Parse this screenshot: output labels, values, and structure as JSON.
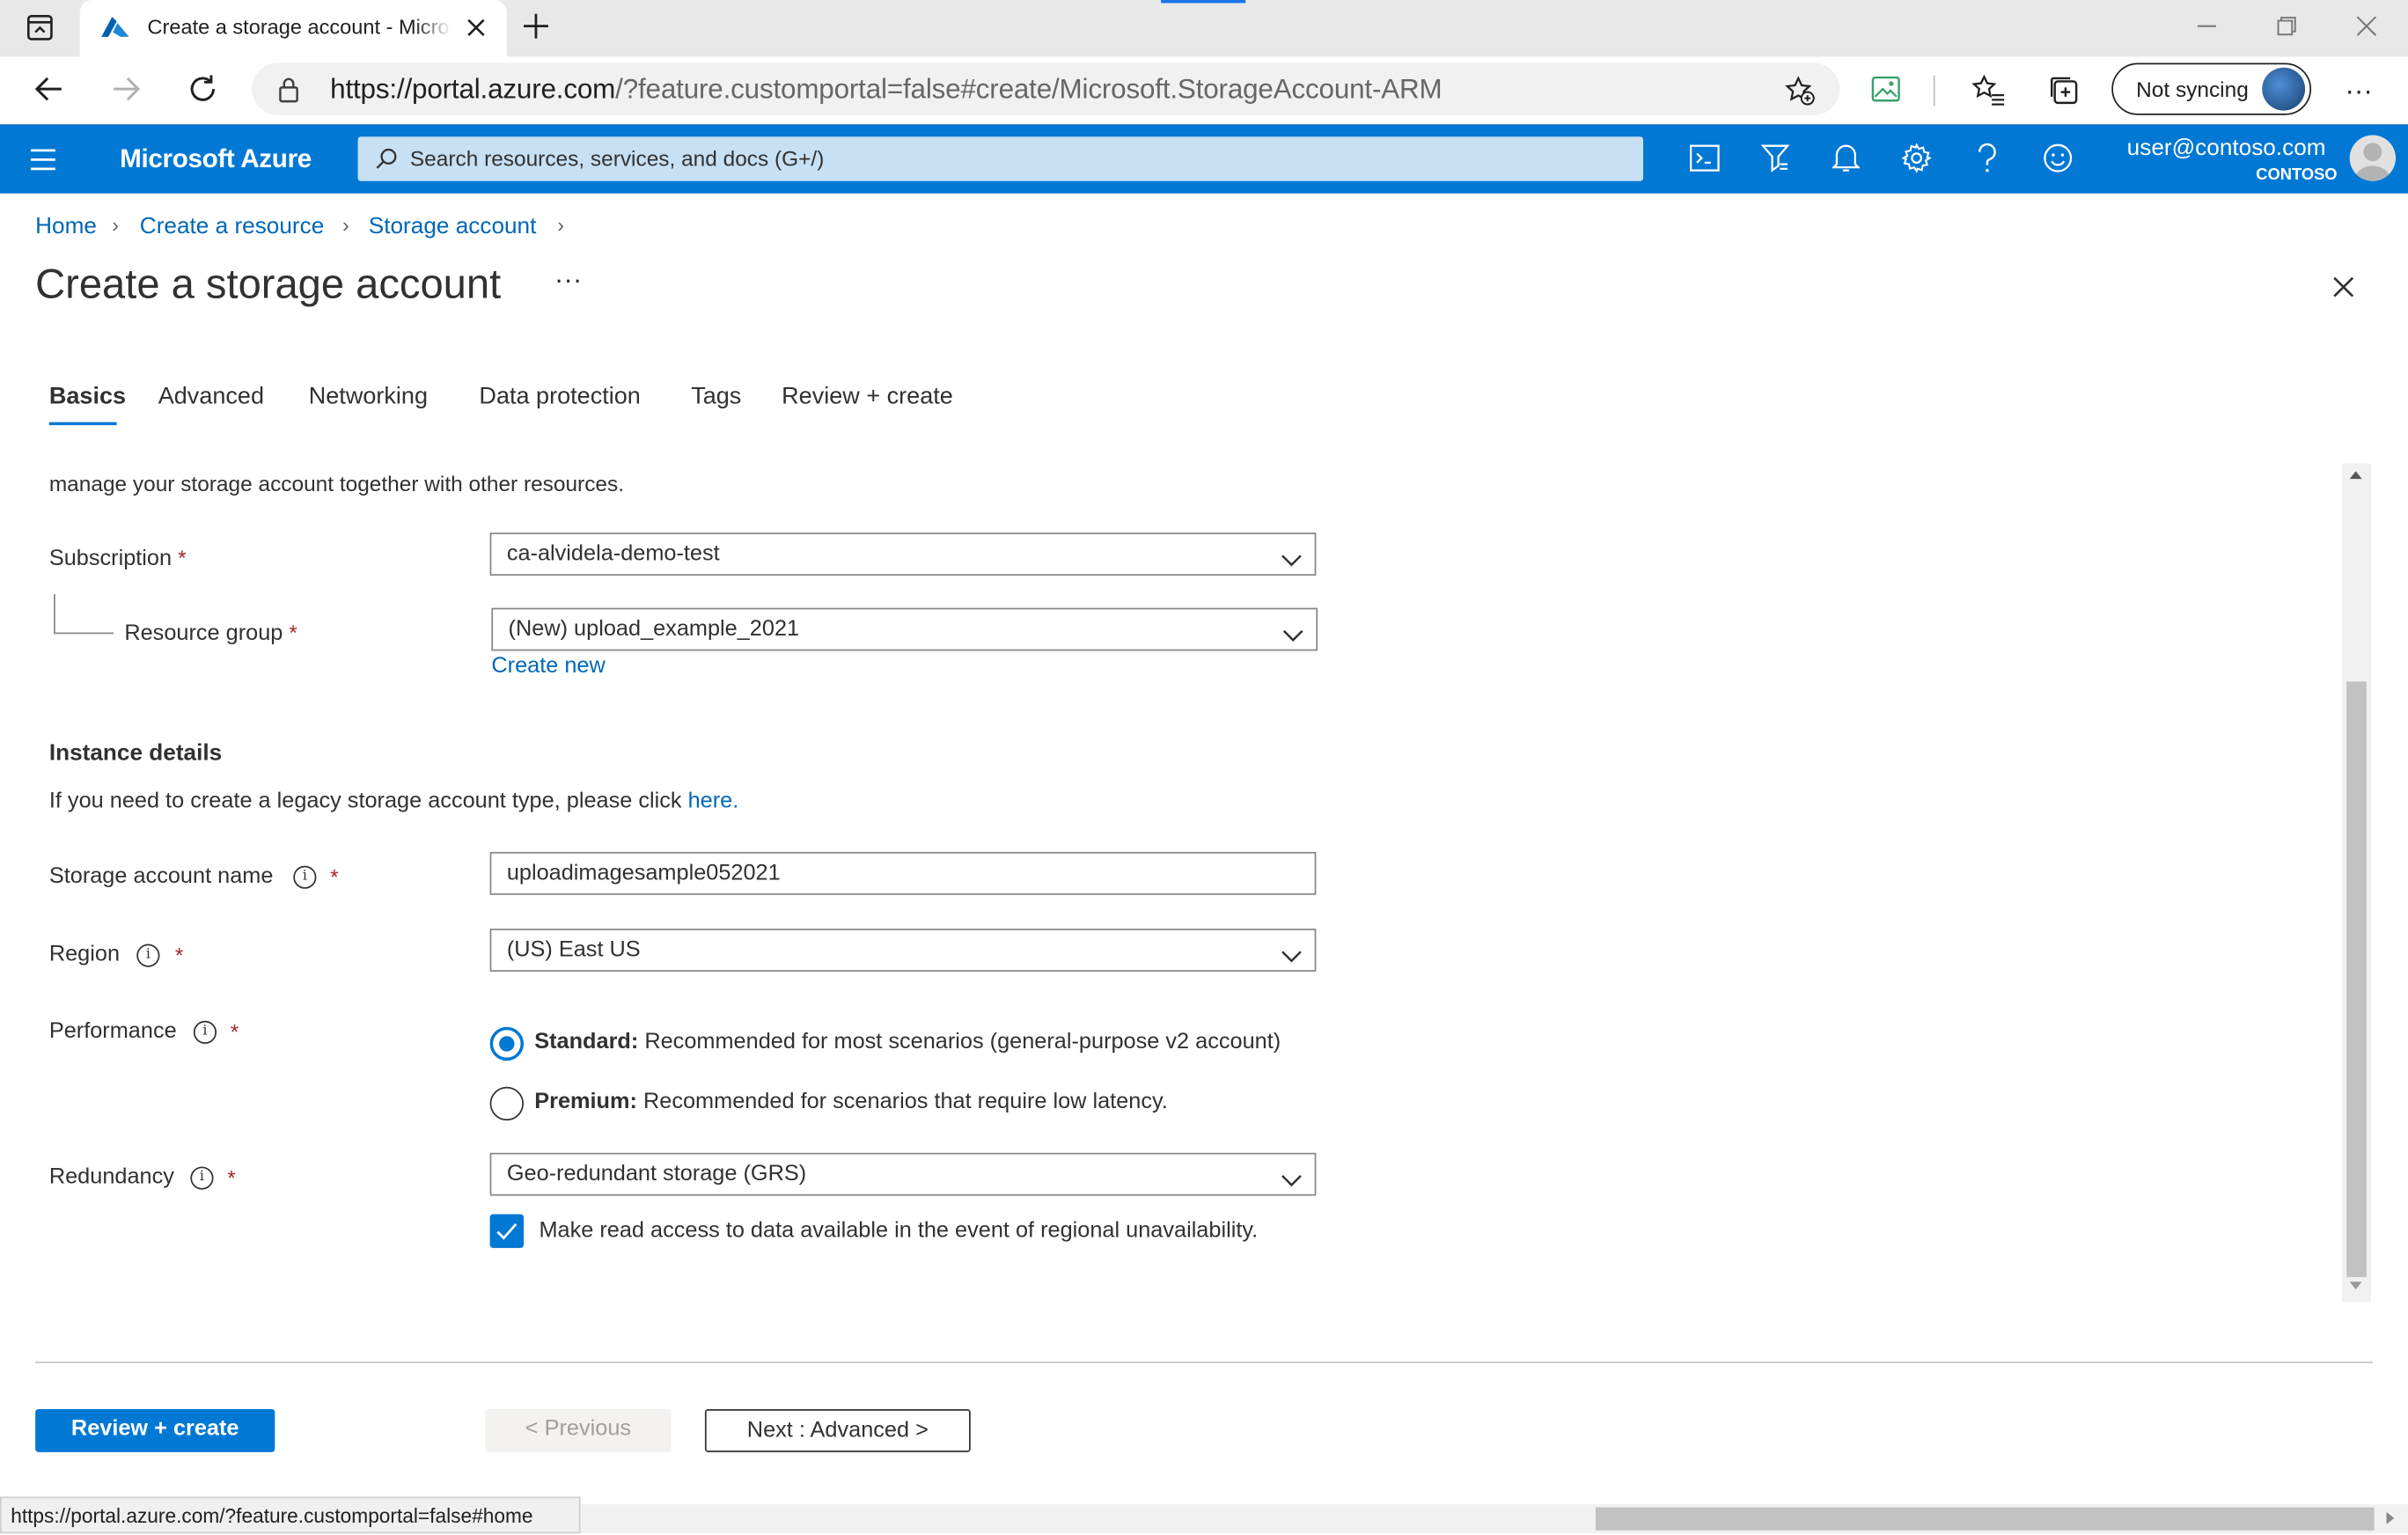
{
  "browser": {
    "tab_title": "Create a storage account - Microsoft Azure",
    "new_tab_label": "+",
    "url_host": "https://portal.azure.com",
    "url_path": "/?feature.customportal=false#create/Microsoft.StorageAccount-ARM",
    "sync_label": "Not syncing",
    "status_url": "https://portal.azure.com/?feature.customportal=false#home"
  },
  "azure": {
    "brand": "Microsoft Azure",
    "search_placeholder": "Search resources, services, and docs (G+/)",
    "user_email": "user@contoso.com",
    "user_tenant": "CONTOSO"
  },
  "breadcrumb": [
    "Home",
    "Create a resource",
    "Storage account"
  ],
  "page": {
    "title": "Create a storage account",
    "more": "···"
  },
  "tabs": [
    "Basics",
    "Advanced",
    "Networking",
    "Data protection",
    "Tags",
    "Review + create"
  ],
  "form": {
    "intro_tail": "manage your storage account together with other resources.",
    "subscription_label": "Subscription",
    "subscription_value": "ca-alvidela-demo-test",
    "resource_group_label": "Resource group",
    "resource_group_value": "(New) upload_example_2021",
    "create_new_link": "Create new",
    "instance_heading": "Instance details",
    "legacy_text": "If you need to create a legacy storage account type, please click",
    "legacy_link": "here.",
    "storage_name_label": "Storage account name",
    "storage_name_value": "uploadimagesample052021",
    "region_label": "Region",
    "region_value": "(US) East US",
    "performance_label": "Performance",
    "perf_standard_bold": "Standard:",
    "perf_standard_text": "Recommended for most scenarios (general-purpose v2 account)",
    "perf_premium_bold": "Premium:",
    "perf_premium_text": "Recommended for scenarios that require low latency.",
    "redundancy_label": "Redundancy",
    "redundancy_value": "Geo-redundant storage (GRS)",
    "read_access_text": "Make read access to data available in the event of regional unavailability.",
    "required_mark": "*",
    "info_mark": "i"
  },
  "footer": {
    "review_create": "Review + create",
    "previous": "< Previous",
    "next": "Next : Advanced >"
  },
  "colors": {
    "azure_blue": "#0078d4",
    "search_bg": "#c7e0f4",
    "link": "#0067b8",
    "required": "#a4262c"
  },
  "state": {
    "selected_tab": "Basics",
    "performance_selected": "Standard",
    "read_access_checked": true
  }
}
